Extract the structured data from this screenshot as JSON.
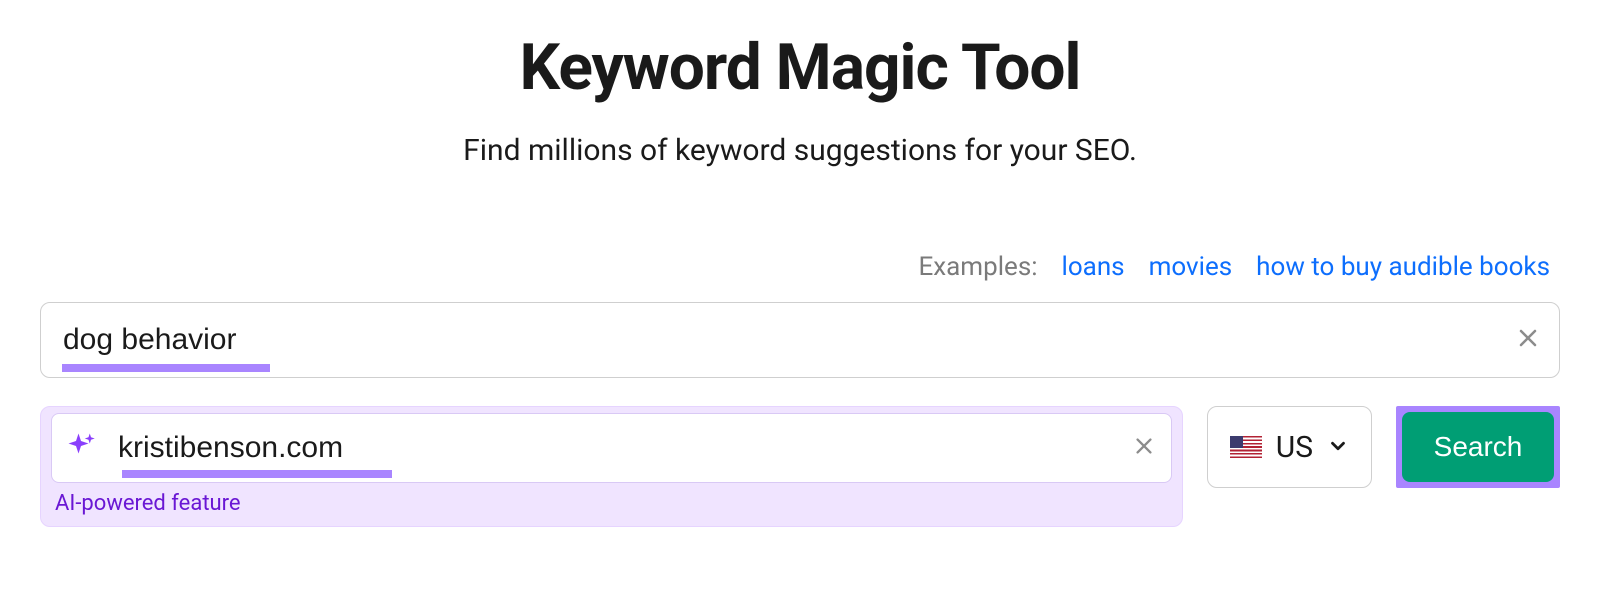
{
  "header": {
    "title": "Keyword Magic Tool",
    "subtitle": "Find millions of keyword suggestions for your SEO."
  },
  "examples": {
    "label": "Examples:",
    "items": [
      "loans",
      "movies",
      "how to buy audible books"
    ]
  },
  "search": {
    "keyword_value": "dog behavior",
    "domain_value": "kristibenson.com",
    "ai_caption": "AI-powered feature",
    "country_code": "US",
    "search_label": "Search"
  }
}
